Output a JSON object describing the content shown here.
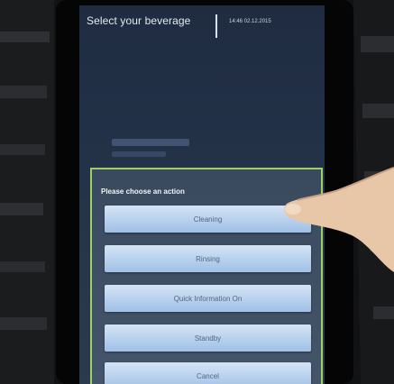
{
  "screen": {
    "title": "Select your beverage",
    "datetime": "14:46  02.12.2015"
  },
  "dialog": {
    "prompt": "Please choose an action",
    "actions": [
      "Cleaning",
      "Rinsing",
      "Quick Information On",
      "Standby",
      "Cancel"
    ]
  },
  "colors": {
    "dialog_border": "#9ed06a",
    "button_top": "#d5e4f5",
    "button_bottom": "#9fc0e6"
  }
}
